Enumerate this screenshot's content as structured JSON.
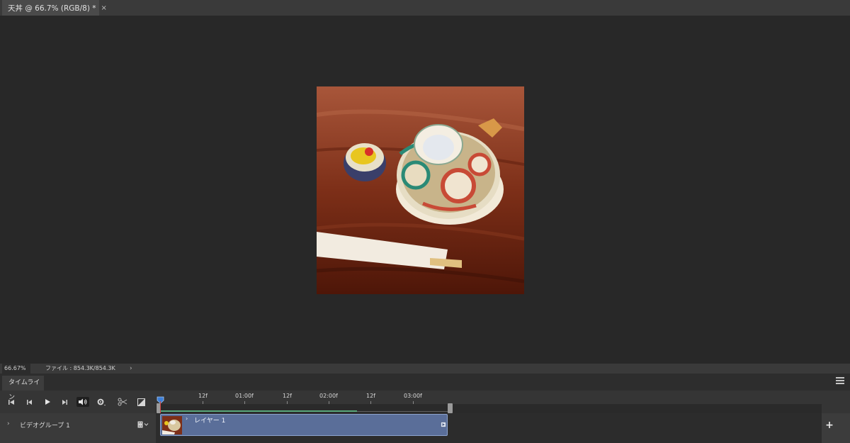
{
  "document": {
    "tab_title": "天丼 @ 66.7% (RGB/8) *",
    "close_glyph": "×"
  },
  "status": {
    "zoom": "66.67%",
    "file_info": "ファイル : 854.3K/854.3K",
    "arrow": "›"
  },
  "timeline": {
    "tab_label": "タイムライン",
    "ruler_labels": [
      "12f",
      "01:00f",
      "12f",
      "02:00f",
      "12f",
      "03:00f"
    ],
    "track": {
      "chevron": "›",
      "name": "ビデオグループ 1",
      "menu_glyph": "▾",
      "clip_chevron": "›",
      "clip_name": "レイヤー 1"
    },
    "add_label": "+"
  },
  "icons": {
    "first_frame": "first-frame-icon",
    "prev_frame": "prev-frame-icon",
    "play": "play-icon",
    "next_frame": "next-frame-icon",
    "audio": "speaker-icon",
    "settings": "gear-icon",
    "split": "scissors-icon",
    "transition": "transition-icon"
  },
  "colors": {
    "clip": "#5a6e99",
    "work_area": "#5aa87c",
    "playhead": "#c94545"
  }
}
